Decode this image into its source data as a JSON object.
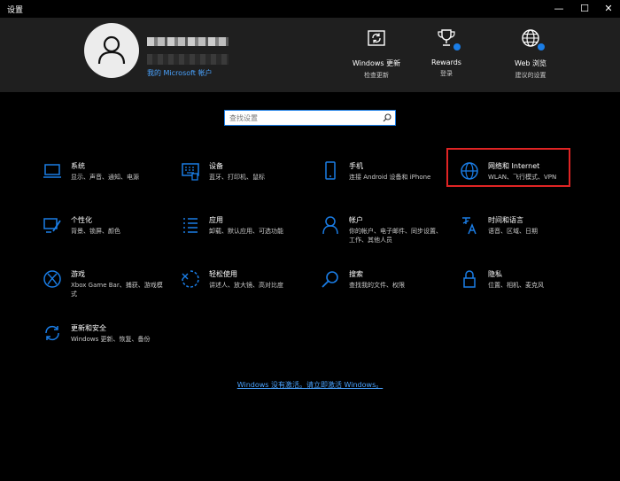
{
  "window": {
    "title": "设置",
    "minimize": "—",
    "maximize": "☐",
    "close": "✕"
  },
  "header": {
    "account_link": "我的 Microsoft 帐户",
    "quick_links": [
      {
        "title": "Windows 更新",
        "subtitle": "检查更新",
        "icon": "sync-icon"
      },
      {
        "title": "Rewards",
        "subtitle": "登录",
        "icon": "trophy-icon"
      },
      {
        "title": "Web 浏览",
        "subtitle": "建议的设置",
        "icon": "globe-icon"
      }
    ]
  },
  "search": {
    "placeholder": "查找设置"
  },
  "tiles": [
    {
      "title": "系统",
      "subtitle": "显示、声音、通知、电源"
    },
    {
      "title": "设备",
      "subtitle": "蓝牙、打印机、鼠标"
    },
    {
      "title": "手机",
      "subtitle": "连接 Android 设备和 iPhone"
    },
    {
      "title": "网络和 Internet",
      "subtitle": "WLAN、飞行模式、VPN"
    },
    {
      "title": "个性化",
      "subtitle": "背景、锁屏、颜色"
    },
    {
      "title": "应用",
      "subtitle": "卸载、默认应用、可选功能"
    },
    {
      "title": "帐户",
      "subtitle": "你的帐户、电子邮件、同步设置、工作、其他人员"
    },
    {
      "title": "时间和语言",
      "subtitle": "语音、区域、日期"
    },
    {
      "title": "游戏",
      "subtitle": "Xbox Game Bar、捕获、游戏模式"
    },
    {
      "title": "轻松使用",
      "subtitle": "讲述人、放大镜、高对比度"
    },
    {
      "title": "搜索",
      "subtitle": "查找我的文件、权限"
    },
    {
      "title": "隐私",
      "subtitle": "位置、相机、麦克风"
    },
    {
      "title": "更新和安全",
      "subtitle": "Windows 更新、恢复、备份"
    }
  ],
  "activation_link": "Windows 没有激活。请立即激活 Windows。",
  "colors": {
    "accent": "#1a7de6",
    "highlight": "#e02424",
    "header_bg": "#1f1f1f"
  }
}
